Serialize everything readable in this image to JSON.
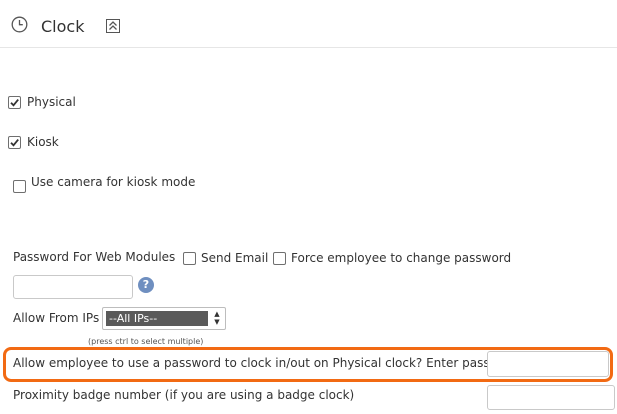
{
  "header": {
    "title": "Clock"
  },
  "options": {
    "physical": {
      "label": "Physical",
      "checked": true
    },
    "kiosk": {
      "label": "Kiosk",
      "checked": true
    },
    "use_camera": {
      "label": "Use camera for kiosk mode",
      "checked": false
    }
  },
  "password_web": {
    "label": "Password For Web Modules",
    "password_value": "",
    "send_email": {
      "label": "Send Email",
      "checked": false
    },
    "force_change": {
      "label": "Force employee to change password",
      "checked": false
    },
    "help_icon": "?"
  },
  "allow_ips": {
    "label": "Allow From IPs",
    "selected": "--All IPs--",
    "hint": "(press ctrl to select multiple)"
  },
  "clock_password": {
    "label": "Allow employee to use a password to clock in/out on Physical clock? Enter password",
    "value": "",
    "highlight_color": "#f26a13"
  },
  "proximity_badge": {
    "label": "Proximity badge number (if you are using a badge clock)",
    "value": ""
  },
  "icons": {
    "clock": "clock-icon",
    "collapse": "collapse-icon",
    "help": "help-icon"
  }
}
